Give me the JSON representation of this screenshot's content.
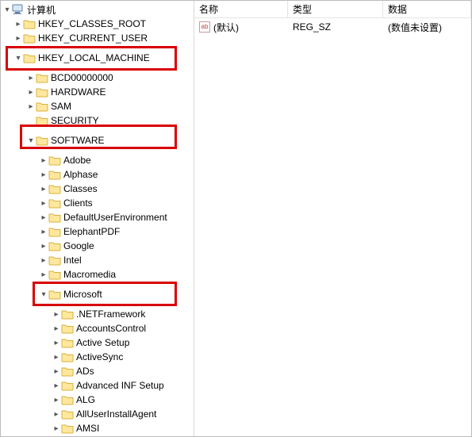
{
  "header": {
    "name": "名称",
    "type": "类型",
    "data": "数据"
  },
  "rows": [
    {
      "name": "(默认)",
      "type": "REG_SZ",
      "data": "(数值未设置)"
    }
  ],
  "tree": {
    "root": {
      "label": "计算机",
      "icon": "computer",
      "expand": "▾"
    },
    "hkcr": {
      "label": "HKEY_CLASSES_ROOT",
      "expand": "▸"
    },
    "hkcu": {
      "label": "HKEY_CURRENT_USER",
      "expand": "▸"
    },
    "hklm": {
      "label": "HKEY_LOCAL_MACHINE",
      "expand": "▾"
    },
    "bcd": {
      "label": "BCD00000000",
      "expand": "▸"
    },
    "hw": {
      "label": "HARDWARE",
      "expand": "▸"
    },
    "sam": {
      "label": "SAM",
      "expand": "▸"
    },
    "sec": {
      "label": "SECURITY",
      "expand": ""
    },
    "sw": {
      "label": "SOFTWARE",
      "expand": "▾"
    },
    "adobe": {
      "label": "Adobe",
      "expand": "▸"
    },
    "alphase": {
      "label": "Alphase",
      "expand": "▸"
    },
    "classes": {
      "label": "Classes",
      "expand": "▸"
    },
    "clients": {
      "label": "Clients",
      "expand": "▸"
    },
    "due": {
      "label": "DefaultUserEnvironment",
      "expand": "▸"
    },
    "epdf": {
      "label": "ElephantPDF",
      "expand": "▸"
    },
    "google": {
      "label": "Google",
      "expand": "▸"
    },
    "intel": {
      "label": "Intel",
      "expand": "▸"
    },
    "macro": {
      "label": "Macromedia",
      "expand": "▸"
    },
    "ms": {
      "label": "Microsoft",
      "expand": "▾"
    },
    "netfw": {
      "label": ".NETFramework",
      "expand": "▸"
    },
    "acct": {
      "label": "AccountsControl",
      "expand": "▸"
    },
    "actset": {
      "label": "Active Setup",
      "expand": "▸"
    },
    "async": {
      "label": "ActiveSync",
      "expand": "▸"
    },
    "ads": {
      "label": "ADs",
      "expand": "▸"
    },
    "ainf": {
      "label": "Advanced INF Setup",
      "expand": "▸"
    },
    "alg": {
      "label": "ALG",
      "expand": "▸"
    },
    "auia": {
      "label": "AllUserInstallAgent",
      "expand": "▸"
    },
    "amsi": {
      "label": "AMSI",
      "expand": "▸"
    }
  }
}
